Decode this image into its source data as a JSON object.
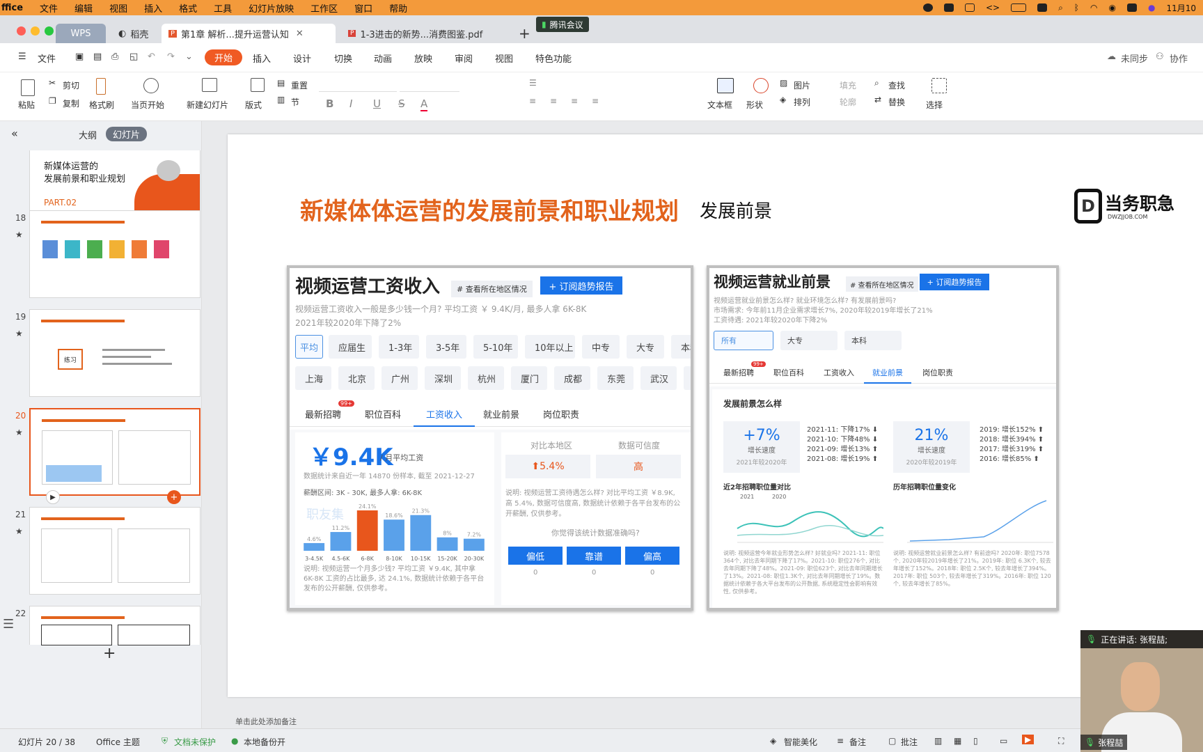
{
  "menubar": {
    "brand": "ffice",
    "items": [
      "文件",
      "编辑",
      "视图",
      "插入",
      "格式",
      "工具",
      "幻灯片放映",
      "工作区",
      "窗口",
      "帮助"
    ],
    "clock": "11月10"
  },
  "tabs": {
    "wps": "WPS",
    "dk": "稻壳",
    "doc1": "第1章 解析...提升运营认知",
    "doc2": "1-3进击的新势...消费图鉴.pdf",
    "plus": "+",
    "meeting": "腾讯会议"
  },
  "ribbon": {
    "file": "文件",
    "items": [
      "开始",
      "插入",
      "设计",
      "切换",
      "动画",
      "放映",
      "审阅",
      "视图",
      "特色功能"
    ],
    "unsync": "未同步",
    "collab": "协作"
  },
  "tools": {
    "paste": "粘贴",
    "cut": "剪切",
    "copy": "复制",
    "format": "格式刷",
    "play": "当页开始",
    "newslide": "新建幻灯片",
    "layout": "版式",
    "reset": "重置",
    "section": "节",
    "textbox": "文本框",
    "shape": "形状",
    "picture": "图片",
    "arrange": "排列",
    "fill": "填充",
    "outline": "轮廓",
    "find": "查找",
    "replace": "替换",
    "select": "选择"
  },
  "side": {
    "outline": "大纲",
    "slides": "幻灯片",
    "slide17_title1": "新媒体运营的",
    "slide17_title2": "发展前景和职业规划",
    "slide17_part": "PART.02",
    "nums": [
      "18",
      "19",
      "20",
      "21",
      "22"
    ],
    "exercise": "练习"
  },
  "slide": {
    "title": "新媒体体运营的发展前景和职业规划",
    "subtitle": "发展前景",
    "logo_cn": "当务职急",
    "logo_en": "DWZJJOB.COM",
    "logo_d": "D",
    "notes": "单击此处添加备注"
  },
  "left_card": {
    "title": "视频运营工资收入",
    "tag": "# 查看所在地区情况",
    "subscribe": "+ 订阅趋势报告",
    "desc1": "视频运营工资收入一般是多少钱一个月? 平均工资 ￥ 9.4K/月, 最多人拿 6K-8K",
    "desc2": "2021年较2020年下降了2%",
    "filters1": [
      "平均",
      "应届生",
      "1-3年",
      "3-5年",
      "5-10年",
      "10年以上",
      "中专",
      "大专",
      "本科"
    ],
    "filters2": [
      "上海",
      "北京",
      "广州",
      "深圳",
      "杭州",
      "厦门",
      "成都",
      "东莞",
      "武汉",
      "重"
    ],
    "tabs": [
      "最新招聘",
      "职位百科",
      "工资收入",
      "就业前景",
      "岗位职责"
    ],
    "badge": "99+",
    "salary": "￥9.4K",
    "salary_unit": "/ 月平均工资",
    "stat_note": "数据统计来自近一年 14870 份样本, 截至 2021-12-27",
    "range": "薪酬区间: 3K - 30K, 最多人拿: 6K-8K",
    "watermark": "职友集",
    "compare_label": "对比本地区",
    "reliability_label": "数据可信度",
    "compare_value": "⬆5.4%",
    "reliability_value": "高",
    "explain": "说明: 视频运营工资待遇怎么样? 对比平均工资 ￥8.9K, 高 5.4%, 数据可信度高, 数据统计依赖于各平台发布的公开薪酬, 仅供参考。",
    "question": "你觉得该统计数据准确吗?",
    "votes": [
      "偏低",
      "靠谱",
      "偏高"
    ],
    "vote_counts": [
      "0",
      "0",
      "0"
    ],
    "bottom_note": "说明: 视频运营一个月多少钱? 平均工资 ￥9.4K, 其中拿 6K-8K 工资的占比最多, 达 24.1%, 数据统计依赖于各平台发布的公开薪酬, 仅供参考。"
  },
  "chart_data": {
    "type": "bar",
    "categories": [
      "3-4.5K",
      "4.5-6K",
      "6-8K",
      "8-10K",
      "10-15K",
      "15-20K",
      "20-30K"
    ],
    "values": [
      4.6,
      11.2,
      24.1,
      18.6,
      21.3,
      8,
      7.2
    ],
    "labels": [
      "4.6%",
      "11.2%",
      "24.1%",
      "18.6%",
      "21.3%",
      "8%",
      "7.2%"
    ],
    "highlight": "6-8K",
    "colors": {
      "normal": "#5aa1ea",
      "highlight": "#e8561c"
    }
  },
  "right_card": {
    "title": "视频运营就业前景",
    "tag": "# 查看所在地区情况",
    "subscribe": "+ 订阅趋势报告",
    "desc1": "视频运营就业前景怎么样? 就业环境怎么样? 有发展前景吗?",
    "desc2": "市场需求: 今年前11月企业需求增长7%, 2020年较2019年增长了21%",
    "desc3": "工资待遇: 2021年较2020年下降2%",
    "filters": [
      "所有",
      "大专",
      "本科"
    ],
    "tabs": [
      "最新招聘",
      "职位百科",
      "工资收入",
      "就业前景",
      "岗位职责"
    ],
    "badge": "99+",
    "section": "发展前景怎么样",
    "stat1": {
      "value": "+7%",
      "label": "增长速度",
      "sub": "2021年较2020年"
    },
    "stat2": {
      "value": "21%",
      "label": "增长速度",
      "sub": "2020年较2019年"
    },
    "list1": [
      "2021-11: 下降17% ⬇",
      "2021-10: 下降48% ⬇",
      "2021-09: 增长13% ⬆",
      "2021-08: 增长19% ⬆"
    ],
    "list2": [
      "2019: 增长152% ⬆",
      "2018: 增长394% ⬆",
      "2017: 增长319% ⬆",
      "2016: 增长85% ⬆"
    ],
    "chart1_title": "近2年招聘职位量对比",
    "chart2_title": "历年招聘职位量变化",
    "legend1": [
      "2021",
      "2020"
    ],
    "notes1": "说明: 视频运营今年就业形势怎么样? 好就业吗? 2021-11: 职位364个, 对比去年同期下降了17%。2021-10: 职位276个, 对比去年同期下降了48%。2021-09: 职位623个, 对比去年同期增长了13%。2021-08: 职位1.3K个, 对比去年同期增长了19%。数据统计依赖于各大平台发布的公开数据, 系统稳定性会影响有效性, 仅供参考。",
    "notes2": "说明: 视频运营就业前景怎么样? 有前途吗? 2020年: 职位7578个, 2020年较2019年增长了21%。2019年: 职位 6.3K个, 较去年增长了152%。2018年: 职位 2.5K个, 较去年增长了394%。2017年: 职位 503个, 较去年增长了319%。2016年: 职位 120个, 较去年增长了85%。"
  },
  "status": {
    "slide": "幻灯片 20 / 38",
    "theme": "Office 主题",
    "protect": "文档未保护",
    "backup": "本地备份开",
    "beautify": "智能美化",
    "notes": "备注",
    "comment": "批注",
    "speaker": "张程喆",
    "talking": "正在讲话: 张程喆;"
  },
  "colors": {
    "accent": "#f05a23",
    "title_orange": "#e2631c",
    "blue": "#1a73e8"
  }
}
